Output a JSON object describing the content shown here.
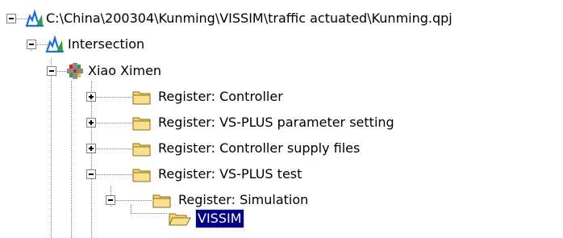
{
  "tree": {
    "nodes": [
      {
        "label": "C:\\China\\200304\\Kunming\\VISSIM\\traffic actuated\\Kunming.qpj",
        "icon": "project-icon",
        "expander": "minus"
      },
      {
        "label": "Intersection",
        "icon": "intersection-icon",
        "expander": "minus"
      },
      {
        "label": "Xiao Ximen",
        "icon": "traffic-junction-icon",
        "expander": "minus"
      },
      {
        "label": "Register: Controller",
        "icon": "folder-icon",
        "expander": "plus"
      },
      {
        "label": "Register: VS-PLUS parameter setting",
        "icon": "folder-icon",
        "expander": "plus"
      },
      {
        "label": "Register: Controller supply files",
        "icon": "folder-icon",
        "expander": "plus"
      },
      {
        "label": "Register: VS-PLUS test",
        "icon": "folder-icon",
        "expander": "minus"
      },
      {
        "label": "Register: Simulation",
        "icon": "folder-icon",
        "expander": "minus"
      },
      {
        "label": "VISSIM",
        "icon": "open-folder-icon",
        "expander": "none",
        "selected": true
      }
    ]
  },
  "colors": {
    "selection_bg": "#000080",
    "selection_text": "#ffffff",
    "folder_fill": "#f5d76e",
    "tree_line": "#808080"
  }
}
